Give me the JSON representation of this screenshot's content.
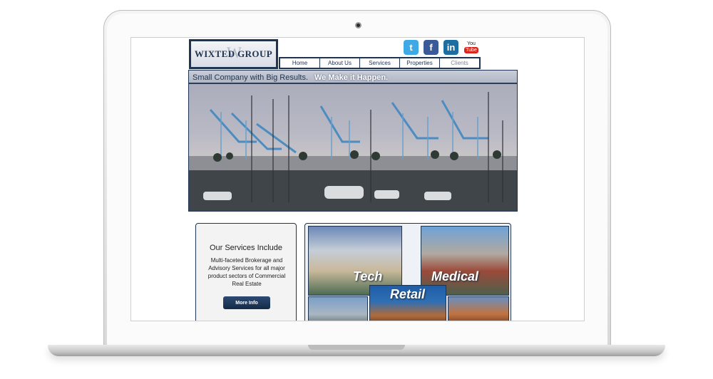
{
  "brand": {
    "logo_text": "WIXTED GROUP",
    "logo_monogram": "W"
  },
  "social": {
    "twitter_glyph": "t",
    "facebook_glyph": "f",
    "linkedin_glyph": "in",
    "youtube_you": "You",
    "youtube_tube": "Tube"
  },
  "nav": {
    "items": [
      {
        "label": "Home"
      },
      {
        "label": "About Us"
      },
      {
        "label": "Services"
      },
      {
        "label": "Properties"
      },
      {
        "label": "Clients"
      }
    ]
  },
  "hero": {
    "tagline": "Small Company with Big Results.",
    "tagline_emphasis": "We Make it Happen."
  },
  "services": {
    "title": "Our Services Include",
    "description": "Multi-faceted Brokerage and Advisory Services for all major product sectors of Commercial Real Estate",
    "button_label": "More Info"
  },
  "sectors": {
    "tech_label": "Tech",
    "medical_label": "Medical",
    "retail_label": "Retail"
  },
  "colors": {
    "brand_navy": "#1e3450",
    "twitter": "#3fa9e6",
    "facebook": "#3b5a9a",
    "linkedin": "#1b6da2",
    "youtube_red": "#d9261c"
  }
}
